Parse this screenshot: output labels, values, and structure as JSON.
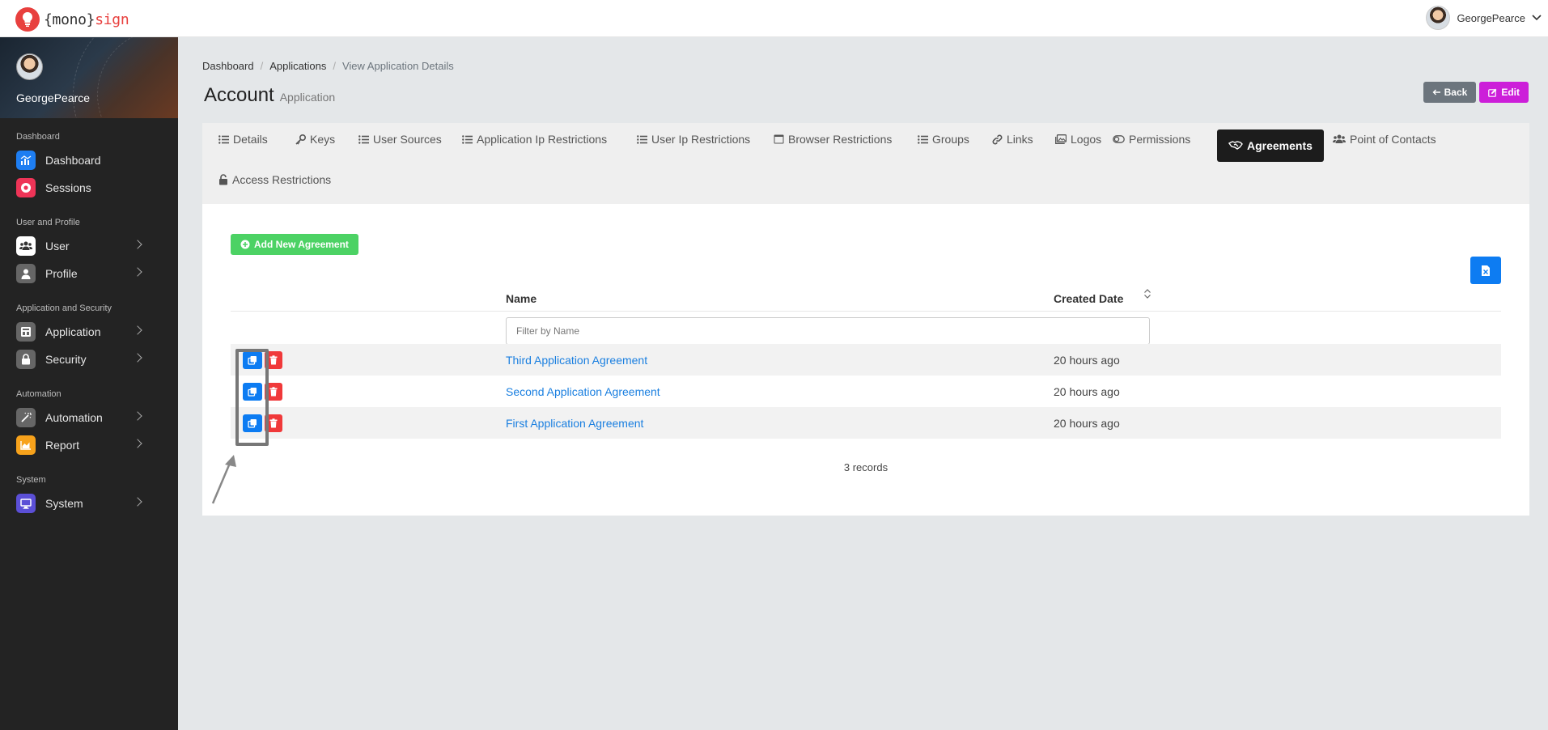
{
  "brand": {
    "prefix": "{mono}",
    "suffix": "sign"
  },
  "topbar": {
    "username": "GeorgePearce"
  },
  "sidebar": {
    "profile_name": "GeorgePearce",
    "sections": [
      {
        "title": "Dashboard",
        "items": [
          {
            "label": "Dashboard",
            "icon": "chart-icon",
            "color": "#1e7ef2"
          },
          {
            "label": "Sessions",
            "icon": "record-icon",
            "color": "#ee3457"
          }
        ]
      },
      {
        "title": "User and Profile",
        "items": [
          {
            "label": "User",
            "icon": "users-icon",
            "color": "#ffffff"
          },
          {
            "label": "Profile",
            "icon": "user-icon",
            "color": "#666666"
          }
        ]
      },
      {
        "title": "Application and Security",
        "items": [
          {
            "label": "Application",
            "icon": "application-icon",
            "color": "#666666"
          },
          {
            "label": "Security",
            "icon": "lock-icon",
            "color": "#666666"
          }
        ]
      },
      {
        "title": "Automation",
        "items": [
          {
            "label": "Automation",
            "icon": "magic-wand-icon",
            "color": "#666666"
          },
          {
            "label": "Report",
            "icon": "area-chart-icon",
            "color": "#f7a21b"
          }
        ]
      },
      {
        "title": "System",
        "items": [
          {
            "label": "System",
            "icon": "monitor-icon",
            "color": "#5b4fd6"
          }
        ]
      }
    ]
  },
  "breadcrumb": [
    "Dashboard",
    "Applications",
    "View Application Details"
  ],
  "page": {
    "title": "Account",
    "subtitle": "Application"
  },
  "buttons": {
    "back": "Back",
    "edit": "Edit"
  },
  "tabs": [
    "Details",
    "Keys",
    "User Sources",
    "Application Ip Restrictions",
    "User Ip Restrictions",
    "Browser Restrictions",
    "Groups",
    "Links",
    "Logos",
    "Permissions",
    "Agreements",
    "Point of Contacts",
    "Access Restrictions"
  ],
  "active_tab": "Agreements",
  "content": {
    "add_button": "Add New Agreement",
    "columns": {
      "name": "Name",
      "created": "Created Date"
    },
    "filter_placeholder": "Filter by Name",
    "rows": [
      {
        "name": "Third Application Agreement",
        "created": "20 hours ago"
      },
      {
        "name": "Second Application Agreement",
        "created": "20 hours ago"
      },
      {
        "name": "First Application Agreement",
        "created": "20 hours ago"
      }
    ],
    "records": "3 records"
  }
}
